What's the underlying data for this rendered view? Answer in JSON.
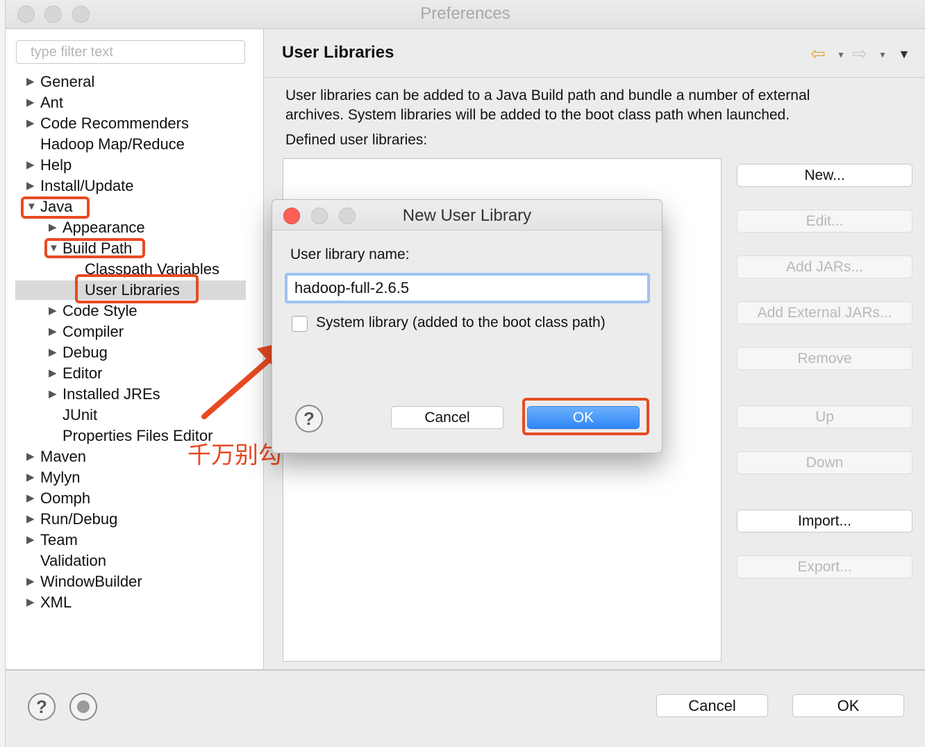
{
  "window": {
    "title": "Preferences"
  },
  "sidebar": {
    "filter_placeholder": "type filter text",
    "items": [
      {
        "label": "General",
        "expander": "collapsed"
      },
      {
        "label": "Ant",
        "expander": "collapsed"
      },
      {
        "label": "Code Recommenders",
        "expander": "collapsed"
      },
      {
        "label": "Hadoop Map/Reduce",
        "expander": "none"
      },
      {
        "label": "Help",
        "expander": "collapsed"
      },
      {
        "label": "Install/Update",
        "expander": "collapsed"
      },
      {
        "label": "Java",
        "expander": "expanded"
      },
      {
        "label": "Appearance",
        "expander": "collapsed"
      },
      {
        "label": "Build Path",
        "expander": "expanded"
      },
      {
        "label": "Classpath Variables",
        "expander": "none"
      },
      {
        "label": "User Libraries",
        "expander": "none",
        "selected": true
      },
      {
        "label": "Code Style",
        "expander": "collapsed"
      },
      {
        "label": "Compiler",
        "expander": "collapsed"
      },
      {
        "label": "Debug",
        "expander": "collapsed"
      },
      {
        "label": "Editor",
        "expander": "collapsed"
      },
      {
        "label": "Installed JREs",
        "expander": "collapsed"
      },
      {
        "label": "JUnit",
        "expander": "none"
      },
      {
        "label": "Properties Files Editor",
        "expander": "none"
      },
      {
        "label": "Maven",
        "expander": "collapsed"
      },
      {
        "label": "Mylyn",
        "expander": "collapsed"
      },
      {
        "label": "Oomph",
        "expander": "collapsed"
      },
      {
        "label": "Run/Debug",
        "expander": "collapsed"
      },
      {
        "label": "Team",
        "expander": "collapsed"
      },
      {
        "label": "Validation",
        "expander": "none"
      },
      {
        "label": "WindowBuilder",
        "expander": "collapsed"
      },
      {
        "label": "XML",
        "expander": "collapsed"
      }
    ]
  },
  "main": {
    "title": "User Libraries",
    "description_line1": "User libraries can be added to a Java Build path and bundle a number of external",
    "description_line2": "archives. System libraries will be added to the boot class path when launched.",
    "defined_label": "Defined user libraries:",
    "buttons": {
      "new": "New...",
      "edit": "Edit...",
      "add_jars": "Add JARs...",
      "add_external_jars": "Add External JARs...",
      "remove": "Remove",
      "up": "Up",
      "down": "Down",
      "import": "Import...",
      "export": "Export..."
    }
  },
  "footer": {
    "cancel": "Cancel",
    "ok": "OK"
  },
  "dialog": {
    "title": "New User Library",
    "name_label": "User library name:",
    "name_value": "hadoop-full-2.6.5",
    "system_library_label": "System library (added to the boot class path)",
    "system_library_checked": false,
    "cancel": "Cancel",
    "ok": "OK"
  },
  "annotation": {
    "text": "千万别勾"
  },
  "icons": {
    "back": "back-arrow-icon",
    "forward": "forward-arrow-icon",
    "menu": "view-menu-icon",
    "help": "help-icon",
    "record": "record-icon"
  },
  "colors": {
    "highlight": "#e84a23",
    "ok_button": "#2f86f6",
    "selection": "#d9d9d9"
  }
}
